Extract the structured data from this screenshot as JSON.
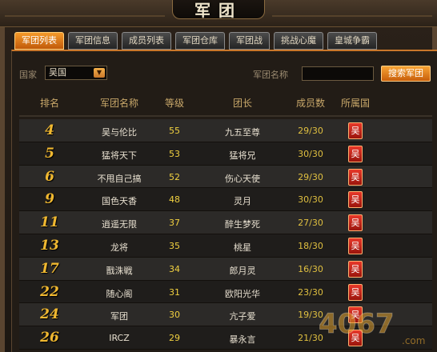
{
  "window": {
    "title": "军团",
    "close_glyph": "×"
  },
  "tabs": [
    {
      "label": "军团列表",
      "active": true
    },
    {
      "label": "军团信息",
      "active": false
    },
    {
      "label": "成员列表",
      "active": false
    },
    {
      "label": "军团仓库",
      "active": false
    },
    {
      "label": "军团战",
      "active": false
    },
    {
      "label": "挑战心魔",
      "active": false
    },
    {
      "label": "皇城争霸",
      "active": false
    }
  ],
  "search": {
    "country_label": "国家",
    "country_value": "吴国",
    "name_label": "军团名称",
    "name_value": "",
    "button_label": "搜索军团"
  },
  "table": {
    "headers": {
      "rank": "排名",
      "name": "军团名称",
      "level": "等级",
      "leader": "团长",
      "members": "成员数",
      "country": "所属国"
    },
    "rows": [
      {
        "rank": "4",
        "name": "吴与伦比",
        "level": "55",
        "leader": "九五至尊",
        "members": "29/30",
        "country": "吴"
      },
      {
        "rank": "5",
        "name": "猛将天下",
        "level": "53",
        "leader": "猛将兄",
        "members": "30/30",
        "country": "吴"
      },
      {
        "rank": "6",
        "name": "不甩自己搞",
        "level": "52",
        "leader": "伤心天使",
        "members": "29/30",
        "country": "吴"
      },
      {
        "rank": "9",
        "name": "国色天香",
        "level": "48",
        "leader": "灵月",
        "members": "30/30",
        "country": "吴"
      },
      {
        "rank": "11",
        "name": "逍遥无限",
        "level": "37",
        "leader": "醉生梦死",
        "members": "27/30",
        "country": "吴"
      },
      {
        "rank": "13",
        "name": "龙将",
        "level": "35",
        "leader": "桃星",
        "members": "18/30",
        "country": "吴"
      },
      {
        "rank": "17",
        "name": "戬洙戦",
        "level": "34",
        "leader": "郎月灵",
        "members": "16/30",
        "country": "吴"
      },
      {
        "rank": "22",
        "name": "随心阁",
        "level": "31",
        "leader": "欧阳光华",
        "members": "23/30",
        "country": "吴"
      },
      {
        "rank": "24",
        "name": "军团",
        "level": "30",
        "leader": "亢子爱",
        "members": "19/30",
        "country": "吴"
      },
      {
        "rank": "26",
        "name": "IRCZ",
        "level": "29",
        "leader": "暴永言",
        "members": "21/30",
        "country": "吴"
      }
    ]
  },
  "watermark": {
    "text": "4067",
    "suffix": ".com"
  },
  "colors": {
    "accent_orange": "#f59a2a",
    "rank_gold": "#f0b830",
    "country_badge_red": "#e8382a"
  }
}
